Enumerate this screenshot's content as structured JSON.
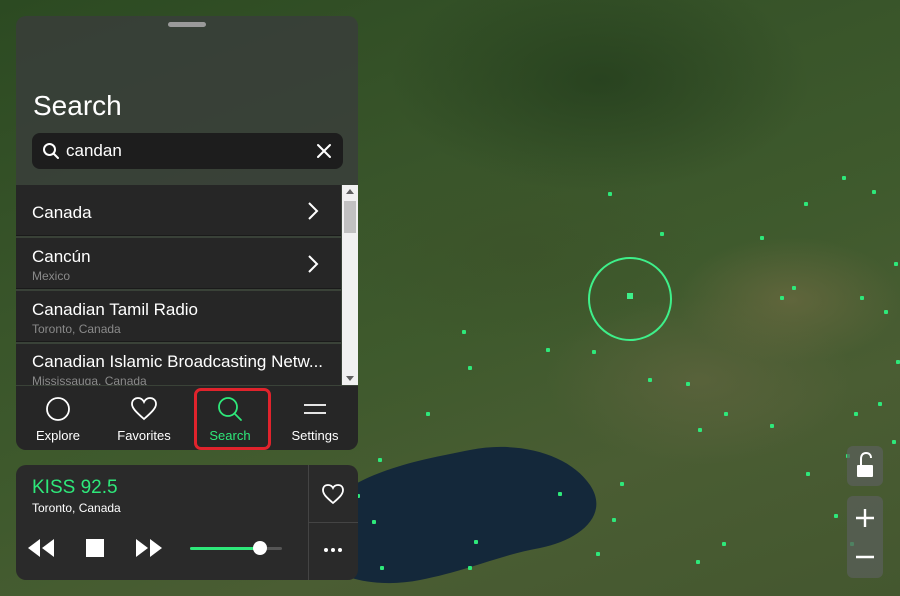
{
  "search_panel": {
    "title": "Search",
    "query": "candan",
    "results": [
      {
        "title": "Canada",
        "subtitle": "",
        "has_chevron": true
      },
      {
        "title": "Cancún",
        "subtitle": "Mexico",
        "has_chevron": true
      },
      {
        "title": "Canadian Tamil Radio",
        "subtitle": "Toronto, Canada",
        "has_chevron": false
      },
      {
        "title": "Canadian Islamic Broadcasting Netw...",
        "subtitle": "Mississauga, Canada",
        "has_chevron": false
      }
    ]
  },
  "tabs": [
    {
      "label": "Explore",
      "icon": "explore-icon",
      "active": false
    },
    {
      "label": "Favorites",
      "icon": "heart-icon",
      "active": false
    },
    {
      "label": "Search",
      "icon": "search-icon",
      "active": true
    },
    {
      "label": "Settings",
      "icon": "settings-icon",
      "active": false
    }
  ],
  "player": {
    "station_name": "KISS 92.5",
    "station_location": "Toronto, Canada",
    "volume": 0.76
  },
  "colors": {
    "accent": "#2ee87a",
    "highlight": "#e0232c",
    "panel": "#262626"
  },
  "icons": [
    "search-icon",
    "clear-icon",
    "chevron-right-icon",
    "explore-icon",
    "heart-icon",
    "settings-icon",
    "rewind-icon",
    "stop-icon",
    "fast-forward-icon",
    "more-icon",
    "unlock-icon",
    "zoom-in-icon",
    "zoom-out-icon"
  ]
}
